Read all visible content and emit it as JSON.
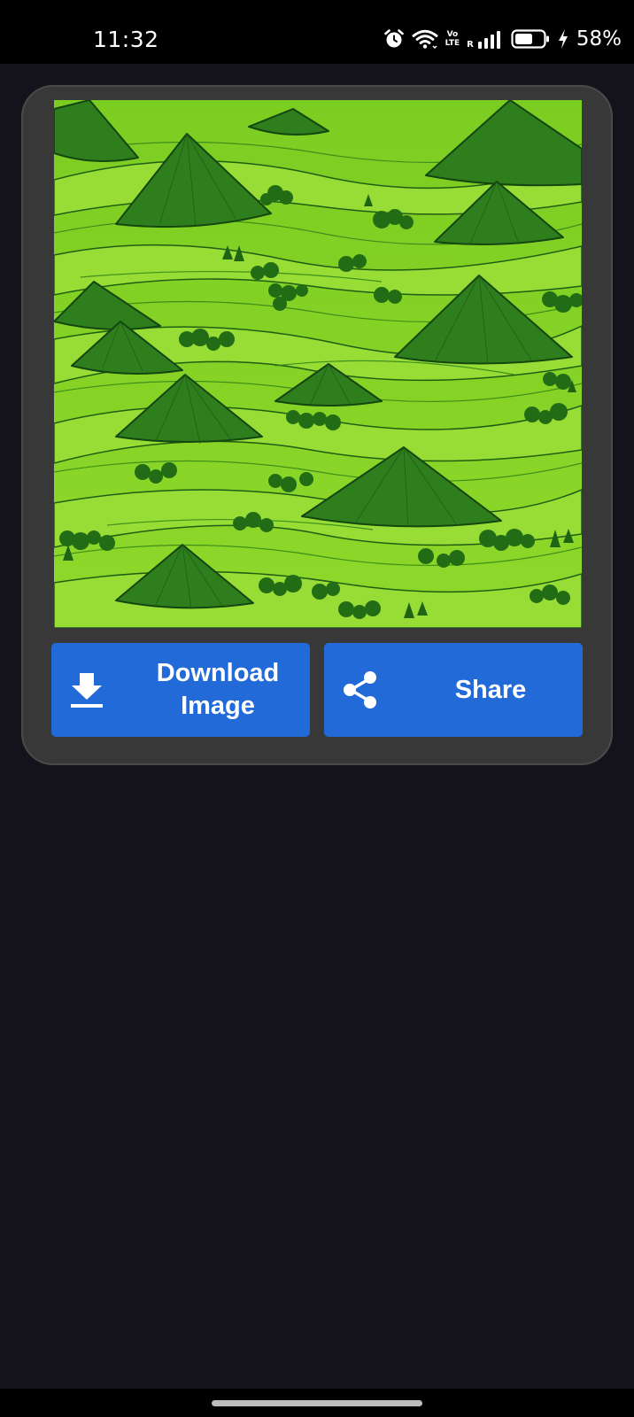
{
  "status_bar": {
    "time": "11:32",
    "network_top": "Vo",
    "network_bottom": "LTE",
    "roaming": "R",
    "battery_percent": "58%",
    "icons": [
      "alarm-icon",
      "wifi-icon",
      "signal-icon",
      "battery-icon",
      "charging-icon"
    ]
  },
  "card": {
    "image": {
      "icon": "generated-landscape-image"
    },
    "download_button": {
      "label": "Download\nImage",
      "icon": "download-icon"
    },
    "share_button": {
      "label": "Share",
      "icon": "share-icon"
    }
  },
  "colors": {
    "background": "#14121a",
    "card": "#383838",
    "button": "#236ad9",
    "status_bar": "#000000"
  }
}
